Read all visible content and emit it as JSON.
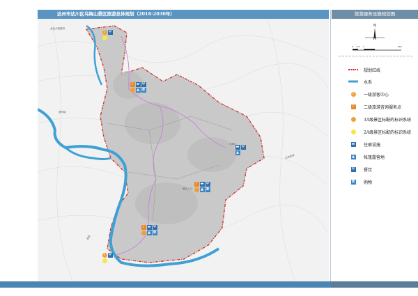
{
  "header": {
    "title": "达州市达川区乌梅山景区旅游总体规划（2018-2030年）",
    "right_title": "旅游服务设施规划图"
  },
  "legend": {
    "items": [
      {
        "label": "规划红线",
        "icon": "red-dash-line"
      },
      {
        "label": "水系",
        "icon": "blue-water-line"
      },
      {
        "label": "一级游客中心",
        "icon": "orange-info-circle-icon"
      },
      {
        "label": "二级旅游咨询服务点",
        "icon": "orange-info-square-icon"
      },
      {
        "label": "3A级景区标配的标识系统",
        "icon": "orange-sign-circle-icon"
      },
      {
        "label": "2A级景区标配的标识系统",
        "icon": "yellow-circle-icon"
      },
      {
        "label": "住宿设施",
        "icon": "bed-icon"
      },
      {
        "label": "帐篷露营地",
        "icon": "tent-icon"
      },
      {
        "label": "餐饮",
        "icon": "fork-knife-icon"
      },
      {
        "label": "购物",
        "icon": "shopping-icon"
      }
    ]
  },
  "scale_bar": {
    "labels": [
      "0",
      "0.5",
      "1",
      "2km"
    ]
  },
  "compass": {
    "north": "N"
  },
  "map_labels": {
    "northwest_town": "龙会乡镇政府",
    "west_town": "渡市镇",
    "east_road": "达渝高速",
    "southwest_road": "省道",
    "center_label_a": "乌梅山",
    "center_label_b": "景区入口"
  },
  "colors": {
    "title_bar": "#5a95c2",
    "red_line": "#c8302c",
    "water": "#3ea1d6",
    "trail": "#c882d6",
    "orange": "#f0a03a",
    "yellow": "#f6e64a",
    "blue_icon": "#2f6fae"
  }
}
